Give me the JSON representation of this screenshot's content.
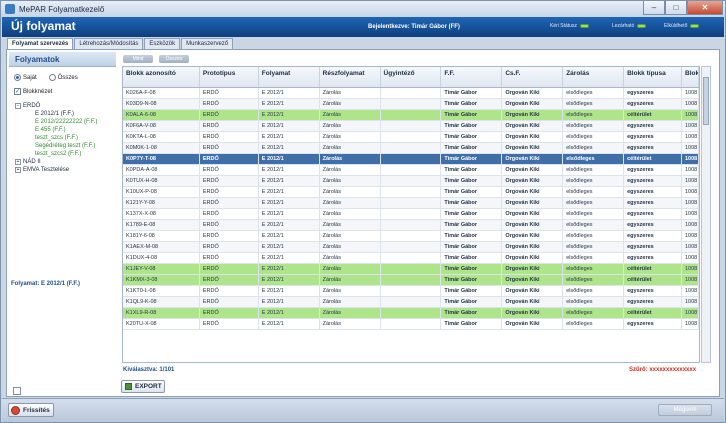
{
  "window": {
    "title": "MePAR Folyamatkezelő",
    "minimize": "–",
    "maximize": "□",
    "close": "✕"
  },
  "header": {
    "title": "Új folyamat",
    "logged_in": "Bejelentkezve: Timár Gábor (FF)",
    "status": [
      {
        "label": "Kéri Státusz"
      },
      {
        "label": "Lezárható"
      },
      {
        "label": "Elküldhető"
      }
    ]
  },
  "tabs": [
    "Folyamat szervezés",
    "Létrehozás/Módosítás",
    "Eszközök",
    "Munkaszervező"
  ],
  "left_panel": {
    "header": "Folyamatok",
    "radio_own": "Saját",
    "radio_all": "Összes",
    "checkbox_block": "Blokknézet",
    "tree": {
      "root1": "ERDŐ",
      "children": [
        {
          "label": "E 2012/1 (F.F.)",
          "color": "dark"
        },
        {
          "label": "E 2012/22222222 (F.F.)",
          "color": "green"
        },
        {
          "label": "E 455 (F.F.)",
          "color": "green"
        },
        {
          "label": "teszt_szcs (F.F.)",
          "color": "green"
        },
        {
          "label": "Segédréteg teszt (F.F.)",
          "color": "green"
        },
        {
          "label": "teszt_szcs2 (F.F.)",
          "color": "green"
        }
      ],
      "root2": "NÁD II",
      "root3": "EMVA Tesztelése"
    },
    "footer": "Folyamat: E 2012/1 (F.F.)"
  },
  "toolbar": {
    "pill1": "Mind",
    "pill2": "Összes"
  },
  "table": {
    "columns": [
      "Blokk azonosító",
      "Prototípus",
      "Folyamat",
      "Részfolyamat",
      "Ügyintéző",
      "F.F.",
      "Cs.F.",
      "Zárolás",
      "Blokk típusa",
      "Blokk"
    ],
    "rows": [
      {
        "style": "",
        "cells": [
          "K026A-F-08",
          "ERDŐ",
          "E 2012/1",
          "Zárolás",
          "",
          "Timár Gábor",
          "Orgován Kiki",
          "elsődleges",
          "egyszeres",
          "1008"
        ]
      },
      {
        "style": "alt",
        "cells": [
          "K03D9-N-08",
          "ERDŐ",
          "E 2012/1",
          "Zárolás",
          "",
          "Timár Gábor",
          "Orgován Kiki",
          "elsődleges",
          "egyszeres",
          "1008"
        ]
      },
      {
        "style": "green",
        "cells": [
          "K0ALA-6-08",
          "ERDŐ",
          "E 2012/1",
          "Zárolás",
          "",
          "Timár Gábor",
          "Orgován Kiki",
          "elsődleges",
          "céltérület",
          "1008"
        ]
      },
      {
        "style": "alt",
        "cells": [
          "K0F6A-V-08",
          "ERDŐ",
          "E 2012/1",
          "Zárolás",
          "",
          "Timár Gábor",
          "Orgován Kiki",
          "elsődleges",
          "egyszeres",
          "1008"
        ]
      },
      {
        "style": "",
        "cells": [
          "K0KTA-L-08",
          "ERDŐ",
          "E 2012/1",
          "Zárolás",
          "",
          "Timár Gábor",
          "Orgován Kiki",
          "elsődleges",
          "egyszeres",
          "1008"
        ]
      },
      {
        "style": "alt",
        "cells": [
          "K0M0K-1-08",
          "ERDŐ",
          "E 2012/1",
          "Zárolás",
          "",
          "Timár Gábor",
          "Orgován Kiki",
          "elsődleges",
          "egyszeres",
          "1008"
        ]
      },
      {
        "style": "sel",
        "cells": [
          "K0P7Y-T-08",
          "ERDŐ",
          "E 2012/1",
          "Zárolás",
          "",
          "Timár Gábor",
          "Orgován Kiki",
          "elsődleges",
          "céltérület",
          "1008"
        ]
      },
      {
        "style": "",
        "cells": [
          "K0PDA-A-08",
          "ERDŐ",
          "E 2012/1",
          "Zárolás",
          "",
          "Timár Gábor",
          "Orgován Kiki",
          "elsődleges",
          "egyszeres",
          "1008"
        ]
      },
      {
        "style": "alt",
        "cells": [
          "K0TUX-H-08",
          "ERDŐ",
          "E 2012/1",
          "Zárolás",
          "",
          "Timár Gábor",
          "Orgován Kiki",
          "elsődleges",
          "egyszeres",
          "1008"
        ]
      },
      {
        "style": "",
        "cells": [
          "K10UX-P-08",
          "ERDŐ",
          "E 2012/1",
          "Zárolás",
          "",
          "Timár Gábor",
          "Orgován Kiki",
          "elsődleges",
          "egyszeres",
          "1008"
        ]
      },
      {
        "style": "alt",
        "cells": [
          "K121Y-Y-08",
          "ERDŐ",
          "E 2012/1",
          "Zárolás",
          "",
          "Timár Gábor",
          "Orgován Kiki",
          "elsődleges",
          "egyszeres",
          "1008"
        ]
      },
      {
        "style": "",
        "cells": [
          "K137X-X-08",
          "ERDŐ",
          "E 2012/1",
          "Zárolás",
          "",
          "Timár Gábor",
          "Orgován Kiki",
          "elsődleges",
          "egyszeres",
          "1008"
        ]
      },
      {
        "style": "alt",
        "cells": [
          "K1789-E-08",
          "ERDŐ",
          "E 2012/1",
          "Zárolás",
          "",
          "Timár Gábor",
          "Orgován Kiki",
          "elsődleges",
          "egyszeres",
          "1008"
        ]
      },
      {
        "style": "",
        "cells": [
          "K181Y-6-08",
          "ERDŐ",
          "E 2012/1",
          "Zárolás",
          "",
          "Timár Gábor",
          "Orgován Kiki",
          "elsődleges",
          "egyszeres",
          "1008"
        ]
      },
      {
        "style": "alt",
        "cells": [
          "K1AEX-M-08",
          "ERDŐ",
          "E 2012/1",
          "Zárolás",
          "",
          "Timár Gábor",
          "Orgován Kiki",
          "elsődleges",
          "egyszeres",
          "1008"
        ]
      },
      {
        "style": "",
        "cells": [
          "K1DUX-4-08",
          "ERDŐ",
          "E 2012/1",
          "Zárolás",
          "",
          "Timár Gábor",
          "Orgován Kiki",
          "elsődleges",
          "egyszeres",
          "1008"
        ]
      },
      {
        "style": "green",
        "cells": [
          "K1JEY-V-08",
          "ERDŐ",
          "E 2012/1",
          "Zárolás",
          "",
          "Timár Gábor",
          "Orgován Kiki",
          "elsődleges",
          "céltérület",
          "1008"
        ]
      },
      {
        "style": "green",
        "cells": [
          "K1KMX-3-08",
          "ERDŐ",
          "E 2012/1",
          "Zárolás",
          "",
          "Timár Gábor",
          "Orgován Kiki",
          "elsődleges",
          "céltérület",
          "1008"
        ]
      },
      {
        "style": "",
        "cells": [
          "K1KT0-L-08",
          "ERDŐ",
          "E 2012/1",
          "Zárolás",
          "",
          "Timár Gábor",
          "Orgován Kiki",
          "elsődleges",
          "egyszeres",
          "1008"
        ]
      },
      {
        "style": "alt",
        "cells": [
          "K1QL9-K-08",
          "ERDŐ",
          "E 2012/1",
          "Zárolás",
          "",
          "Timár Gábor",
          "Orgován Kiki",
          "elsődleges",
          "egyszeres",
          "1008"
        ]
      },
      {
        "style": "green",
        "cells": [
          "K1XL9-R-08",
          "ERDŐ",
          "E 2012/1",
          "Zárolás",
          "",
          "Timár Gábor",
          "Orgován Kiki",
          "elsődleges",
          "céltérület",
          "1008"
        ]
      },
      {
        "style": "",
        "cells": [
          "K20TU-X-08",
          "ERDŐ",
          "E 2012/1",
          "Zárolás",
          "",
          "Timár Gábor",
          "Orgován Kiki",
          "elsődleges",
          "egyszeres",
          "1008"
        ]
      }
    ]
  },
  "count_label": "Kiválasztva: 1/101",
  "filter_label": "Szűrő: xxxxxxxxxxxxxx",
  "export_label": "EXPORT",
  "bottom": {
    "refresh": "Frissítés",
    "cancel": "Mégsem"
  },
  "colors": {
    "header_blue": "#1a5aa6",
    "selected_row": "#3f6fa8",
    "green_row": "#aee58a",
    "filter_red": "#d42b1f"
  }
}
